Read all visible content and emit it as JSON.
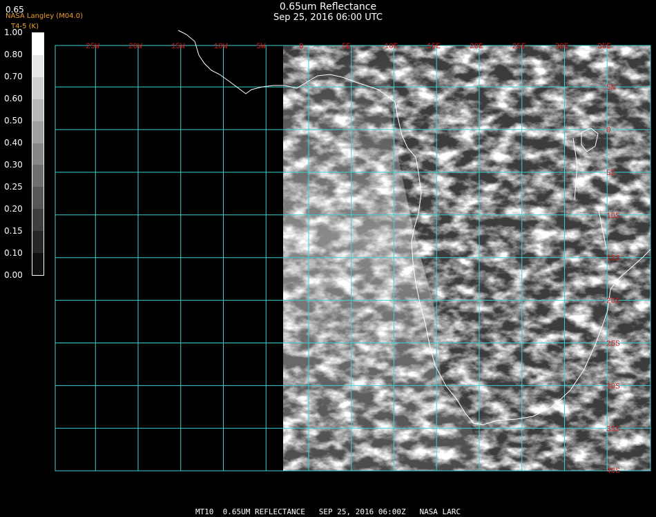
{
  "header": {
    "title": "0.65um Reflectance",
    "datetime": "Sep 25, 2016 06:00 UTC"
  },
  "corner": {
    "band": "0.65",
    "source": "NASA Langley (M04.0)",
    "tag": "T4-5 (K)"
  },
  "colorbar": {
    "labels": [
      "1.00",
      "0.80",
      "0.70",
      "0.60",
      "0.50",
      "0.40",
      "0.30",
      "0.25",
      "0.20",
      "0.15",
      "0.10",
      "0.00"
    ]
  },
  "map": {
    "lon_labels": [
      "25W",
      "20W",
      "15W",
      "10W",
      "5W",
      "0",
      "5E",
      "10E",
      "15E",
      "20E",
      "25E",
      "30E",
      "35E"
    ],
    "lat_labels": [
      "5N",
      "0",
      "5S",
      "10S",
      "15S",
      "20S",
      "25S",
      "30S",
      "35S",
      "40S"
    ],
    "grid_color": "#3fd0d8",
    "label_color": "#d02020"
  },
  "footer": {
    "text": "MT10  0.65UM REFLECTANCE   SEP 25, 2016 06:00Z   NASA LARC"
  }
}
